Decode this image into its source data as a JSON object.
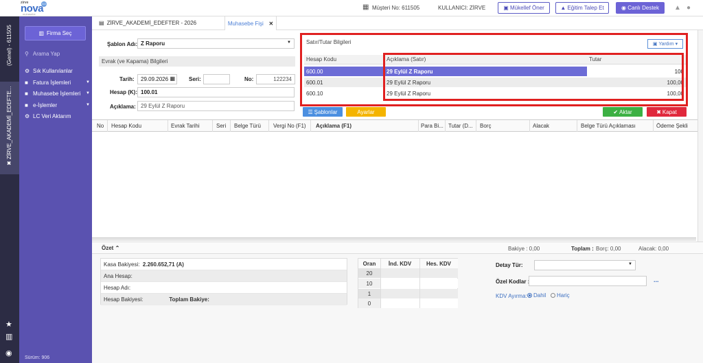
{
  "topbar": {
    "logo_brand": "zirve",
    "logo_name": "nova",
    "logo_sub": "muhasebe",
    "logo_badge": "3.0",
    "musteri": "Müşteri No: 611505",
    "kullanici": "KULLANICI: ZİRVE",
    "btn_mukellef": "Mükellef Öner",
    "btn_egitim": "Eğitim Talep Et",
    "btn_destek": "Canlı Destek"
  },
  "strip": {
    "genel": "(Genel) - 611505",
    "tab_label": "ZİRVE_AKADEMİ_EDEFTE..."
  },
  "sidebar": {
    "firma_sec": "Firma Seç",
    "search_placeholder": "Arama Yap",
    "items": [
      {
        "label": "Sık Kullanılanlar"
      },
      {
        "label": "Fatura İşlemleri"
      },
      {
        "label": "Muhasebe İşlemleri"
      },
      {
        "label": "e-İşlemler"
      },
      {
        "label": "LC Veri Aktarım"
      }
    ],
    "version": "Sürüm: 906"
  },
  "tabs": {
    "company": "ZİRVE_AKADEMİ_EDEFTER - 2026",
    "active": "Muhasebe Fişi"
  },
  "form": {
    "sablon_label": "Şablon Adı:",
    "sablon_value": "Z Raporu",
    "section": "Evrak (ve Kapama) Bilgileri",
    "tarih_label": "Tarih:",
    "tarih_value": "29.09.2026",
    "seri_label": "Seri:",
    "seri_value": "",
    "no_label": "No:",
    "no_value": "122234",
    "hesap_label": "Hesap (K):",
    "hesap_value": "100.01",
    "aciklama_label": "Açıklama:",
    "aciklama_value": "29 Eylül Z Raporu"
  },
  "satir": {
    "title": "Satır/Tutar Bilgileri",
    "yardim": "Yardım",
    "headers": [
      "Hesap Kodu",
      "Açıklama (Satır)",
      "Tutar"
    ],
    "rows": [
      {
        "kod": "600.00",
        "aciklama": "29 Eylül Z Raporu",
        "tutar": "100"
      },
      {
        "kod": "600.01",
        "aciklama": "29 Eylül Z Raporu",
        "tutar": "100,00"
      },
      {
        "kod": "600.10",
        "aciklama": "29 Eylül Z Raporu",
        "tutar": "100,00"
      }
    ]
  },
  "buttons": {
    "sablonlar": "Şablonlar",
    "ayarlar": "Ayarlar",
    "aktar": "Aktar",
    "kapat": "Kapat"
  },
  "table": {
    "headers": [
      "No",
      "Hesap Kodu",
      "Evrak Tarihi",
      "Seri",
      "Belge Türü",
      "Vergi No (F1)",
      "Açıklama (F1)",
      "Para Bi...",
      "Tutar (D...",
      "Borç",
      "Alacak",
      "Belge Türü Açıklaması",
      "Ödeme Şekli"
    ]
  },
  "ozet": {
    "title": "Özet",
    "bakiye": "Bakiye : 0,00",
    "toplam": "Toplam :",
    "borc": "Borç: 0,00",
    "alacak": "Alacak: 0,00",
    "kasa_label": "Kasa Bakiyesi:",
    "kasa_value": "2.260.652,71 (A)",
    "ana_hesap": "Ana Hesap:",
    "hesap_adi": "Hesap Adı:",
    "hesap_bakiyesi": "Hesap Bakiyesi:",
    "toplam_bakiye": "Toplam Bakiye:",
    "kdv_headers": [
      "Oran",
      "İnd. KDV",
      "Hes. KDV"
    ],
    "kdv_rates": [
      "20",
      "10",
      "1",
      "0"
    ],
    "detay_label": "Detay Tür:",
    "ozel_label": "Özel Kodlar :",
    "ozel_more": "...",
    "kdv_ayirma": "KDV Ayırma:",
    "dahil": "Dahil",
    "haric": "Hariç"
  }
}
